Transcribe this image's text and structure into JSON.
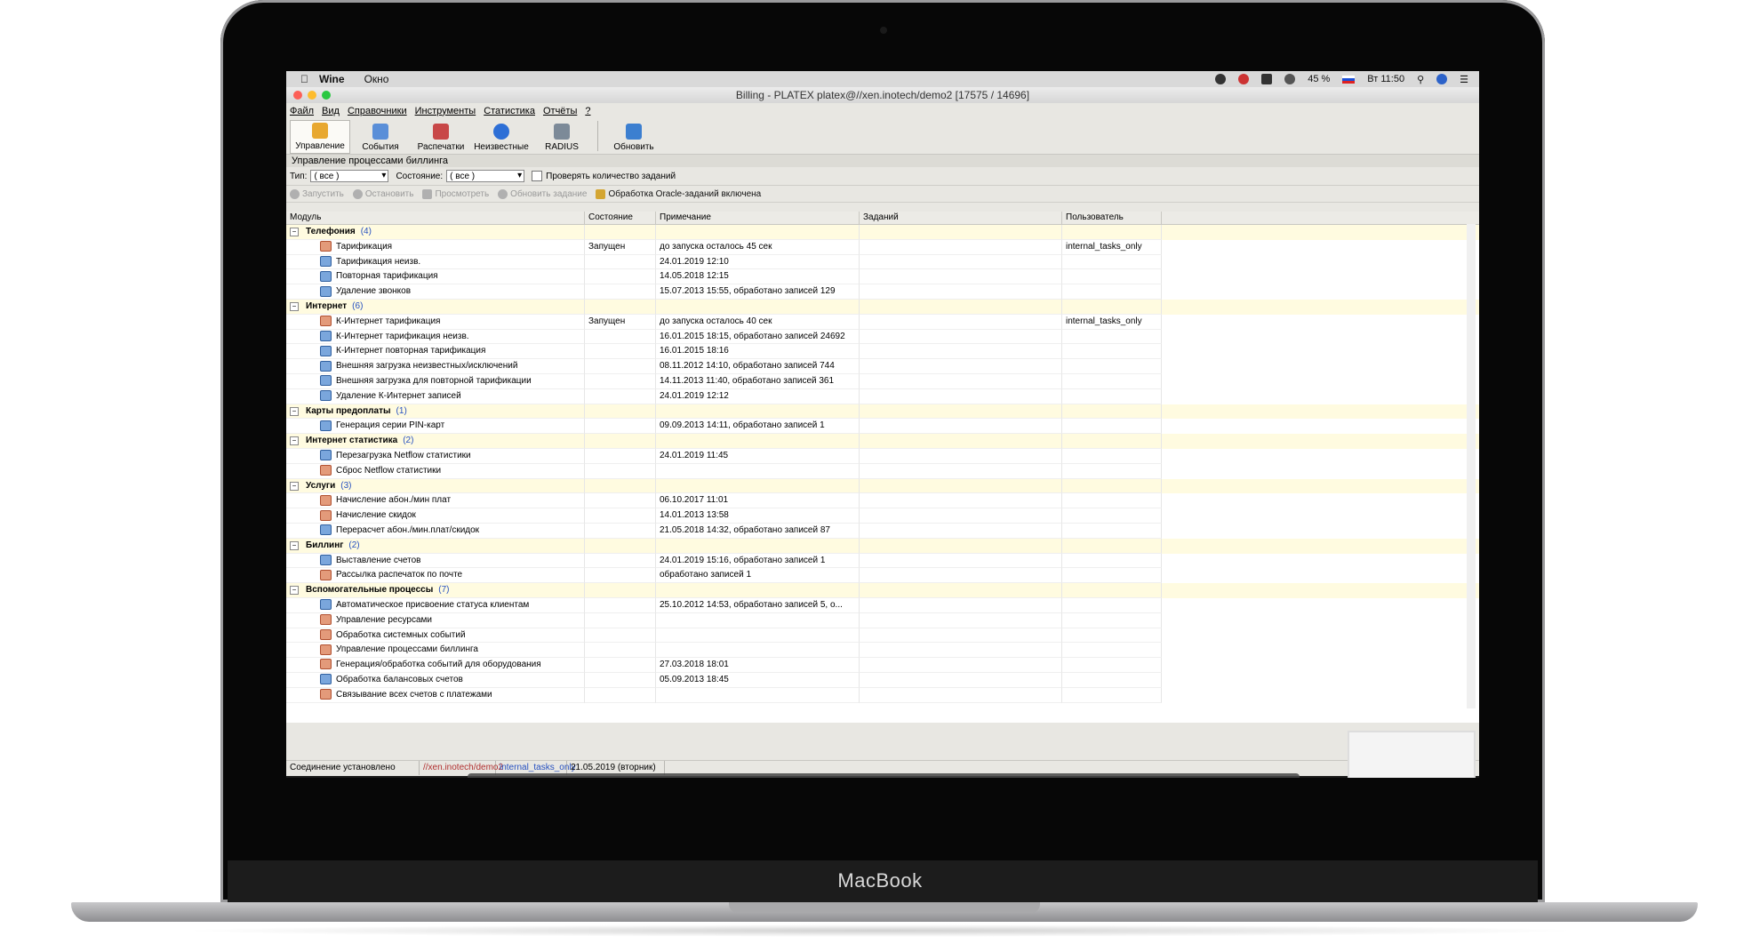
{
  "device": {
    "brand": "MacBook"
  },
  "mac_menubar": {
    "app": "Wine",
    "menu": [
      "Окно"
    ],
    "battery": "45 %",
    "clock": "Вт 11:50"
  },
  "window": {
    "title": "Billing - PLATEX platex@//xen.inotech/demo2 [17575 / 14696]",
    "menu": [
      "Файл",
      "Вид",
      "Справочники",
      "Инструменты",
      "Статистика",
      "Отчёты",
      "?"
    ],
    "toolbar": [
      {
        "label": "Управление",
        "icon": "management-icon",
        "color": "#e8a830"
      },
      {
        "label": "События",
        "icon": "events-icon",
        "color": "#5a8fd8"
      },
      {
        "label": "Распечатки",
        "icon": "printouts-icon",
        "color": "#c84848"
      },
      {
        "label": "Неизвестные",
        "icon": "unknown-icon",
        "color": "#2d6fd6"
      },
      {
        "label": "RADIUS",
        "icon": "radius-icon",
        "color": "#7c8a98"
      },
      {
        "label": "Обновить",
        "icon": "refresh-icon",
        "color": "#3c7fd0"
      }
    ],
    "section_title": "Управление процессами биллинга",
    "filters": {
      "type_label": "Тип:",
      "type_value": "( все )",
      "state_label": "Состояние:",
      "state_value": "( все )",
      "check_label": "Проверять количество заданий"
    },
    "actions": [
      "Запустить",
      "Остановить",
      "Просмотреть",
      "Обновить задание"
    ],
    "oracle_status": "Обработка Oracle-заданий включена",
    "columns": [
      "Модуль",
      "Состояние",
      "Примечание",
      "Заданий",
      "Пользователь"
    ],
    "groups": [
      {
        "name": "Телефония",
        "count": "(4)",
        "rows": [
          {
            "name": "Тарификация",
            "state": "Запущен",
            "note": "до запуска осталось 45 сек",
            "tasks": "",
            "user": "internal_tasks_only",
            "icon": "run"
          },
          {
            "name": "Тарификация неизв.",
            "state": "",
            "note": "24.01.2019 12:10",
            "tasks": "",
            "user": "",
            "icon": "idle"
          },
          {
            "name": "Повторная тарификация",
            "state": "",
            "note": "14.05.2018 12:15",
            "tasks": "",
            "user": "",
            "icon": "idle"
          },
          {
            "name": "Удаление звонков",
            "state": "",
            "note": "15.07.2013 15:55, обработано записей 129",
            "tasks": "",
            "user": "",
            "icon": "idle"
          }
        ]
      },
      {
        "name": "Интернет",
        "count": "(6)",
        "rows": [
          {
            "name": "К-Интернет тарификация",
            "state": "Запущен",
            "note": "до запуска осталось 40 сек",
            "tasks": "",
            "user": "internal_tasks_only",
            "icon": "run"
          },
          {
            "name": "К-Интернет тарификация неизв.",
            "state": "",
            "note": "16.01.2015 18:15, обработано записей 24692",
            "tasks": "",
            "user": "",
            "icon": "idle"
          },
          {
            "name": "К-Интернет повторная тарификация",
            "state": "",
            "note": "16.01.2015 18:16",
            "tasks": "",
            "user": "",
            "icon": "idle"
          },
          {
            "name": "Внешняя загрузка неизвестных/исключений",
            "state": "",
            "note": "08.11.2012 14:10, обработано записей 744",
            "tasks": "",
            "user": "",
            "icon": "idle"
          },
          {
            "name": "Внешняя загрузка для повторной тарификации",
            "state": "",
            "note": "14.11.2013 11:40, обработано записей 361",
            "tasks": "",
            "user": "",
            "icon": "idle"
          },
          {
            "name": "Удаление К-Интернет записей",
            "state": "",
            "note": "24.01.2019 12:12",
            "tasks": "",
            "user": "",
            "icon": "idle"
          }
        ]
      },
      {
        "name": "Карты предоплаты",
        "count": "(1)",
        "rows": [
          {
            "name": "Генерация серии PIN-карт",
            "state": "",
            "note": "09.09.2013 14:11, обработано записей 1",
            "tasks": "",
            "user": "",
            "icon": "idle"
          }
        ]
      },
      {
        "name": "Интернет статистика",
        "count": "(2)",
        "rows": [
          {
            "name": "Перезагрузка Netflow статистики",
            "state": "",
            "note": "24.01.2019 11:45",
            "tasks": "",
            "user": "",
            "icon": "idle"
          },
          {
            "name": "Сброс Netflow статистики",
            "state": "",
            "note": "",
            "tasks": "",
            "user": "",
            "icon": "run"
          }
        ]
      },
      {
        "name": "Услуги",
        "count": "(3)",
        "rows": [
          {
            "name": "Начисление абон./мин плат",
            "state": "",
            "note": "06.10.2017 11:01",
            "tasks": "",
            "user": "",
            "icon": "run"
          },
          {
            "name": "Начисление скидок",
            "state": "",
            "note": "14.01.2013 13:58",
            "tasks": "",
            "user": "",
            "icon": "run"
          },
          {
            "name": "Перерасчет абон./мин.плат/скидок",
            "state": "",
            "note": "21.05.2018 14:32, обработано записей 87",
            "tasks": "",
            "user": "",
            "icon": "idle"
          }
        ]
      },
      {
        "name": "Биллинг",
        "count": "(2)",
        "rows": [
          {
            "name": "Выставление счетов",
            "state": "",
            "note": "24.01.2019 15:16, обработано записей 1",
            "tasks": "",
            "user": "",
            "icon": "idle"
          },
          {
            "name": "Рассылка распечаток по почте",
            "state": "",
            "note": "обработано записей 1",
            "tasks": "",
            "user": "",
            "icon": "run"
          }
        ]
      },
      {
        "name": "Вспомогательные процессы",
        "count": "(7)",
        "rows": [
          {
            "name": "Автоматическое присвоение статуса клиентам",
            "state": "",
            "note": "25.10.2012 14:53, обработано записей 5, о...",
            "tasks": "",
            "user": "",
            "icon": "idle"
          },
          {
            "name": "Управление ресурсами",
            "state": "",
            "note": "",
            "tasks": "",
            "user": "",
            "icon": "run"
          },
          {
            "name": "Обработка системных событий",
            "state": "",
            "note": "",
            "tasks": "",
            "user": "",
            "icon": "run"
          },
          {
            "name": "Управление процессами биллинга",
            "state": "",
            "note": "",
            "tasks": "",
            "user": "",
            "icon": "run"
          },
          {
            "name": "Генерация/обработка событий для оборудования",
            "state": "",
            "note": "27.03.2018 18:01",
            "tasks": "",
            "user": "",
            "icon": "run"
          },
          {
            "name": "Обработка балансовых счетов",
            "state": "",
            "note": "05.09.2013 18:45",
            "tasks": "",
            "user": "",
            "icon": "idle"
          },
          {
            "name": "Связывание всех счетов с платежами",
            "state": "",
            "note": "",
            "tasks": "",
            "user": "",
            "icon": "run"
          }
        ]
      }
    ],
    "statusbar": [
      "Соединение установлено",
      "//xen.inotech/demo2",
      "internal_tasks_only",
      "21.05.2019 (вторник)"
    ]
  },
  "colors": {
    "group_row": "#fffbe0",
    "running_icon": "#e39a7a",
    "idle_icon": "#7aa6dc"
  },
  "dock_colors": [
    "#3a7bd5",
    "#34495e",
    "#888",
    "#222",
    "#2a8ee6",
    "#5a5aa8",
    "#e24",
    "#2aa0f0",
    "#1e9be0",
    "#2fa3d6",
    "#e0457b",
    "#f4f4f4",
    "#2b5797",
    "#6b2f8f",
    "#1a7b4c",
    "#21d789",
    "#f7b731",
    "#3b6fd2",
    "#e94b7b",
    "#1d8cf8",
    "#6d6d6d",
    "#ddd",
    "#e65",
    "#999",
    "#999"
  ]
}
